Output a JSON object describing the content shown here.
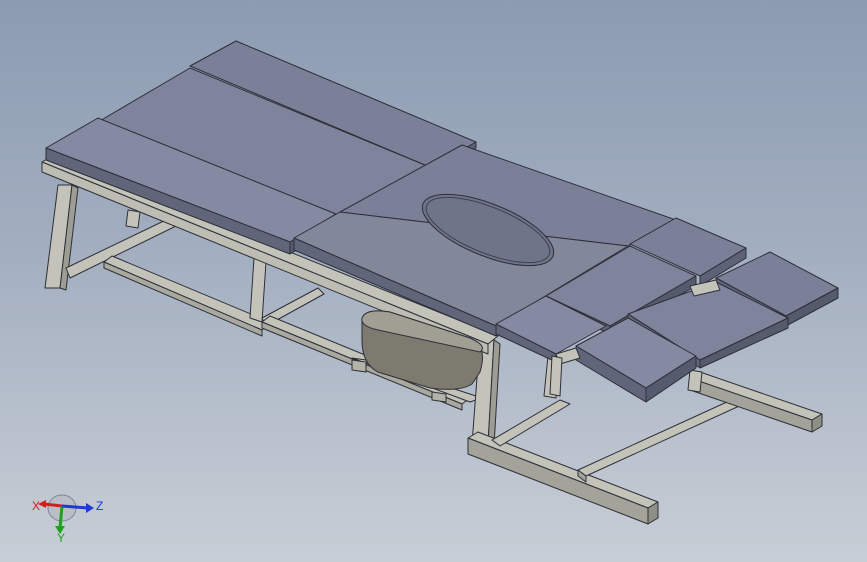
{
  "viewport": {
    "model_name": "",
    "colors": {
      "background_top": "#8c9bb2",
      "background_bottom": "#c8ced6",
      "panel_top": "#7b8098",
      "panel_side": "#5d6276",
      "frame_light": "#cfcfc7",
      "frame_mid": "#b8b8ae",
      "frame_dark": "#8f8f86",
      "tub": "#7d7b6f",
      "edge": "#2d2f38"
    }
  },
  "triad": {
    "x_label": "X",
    "y_label": "Y",
    "z_label": "Z",
    "x_color": "#d11e1e",
    "y_color": "#1ea21e",
    "z_color": "#1e3ad1"
  }
}
